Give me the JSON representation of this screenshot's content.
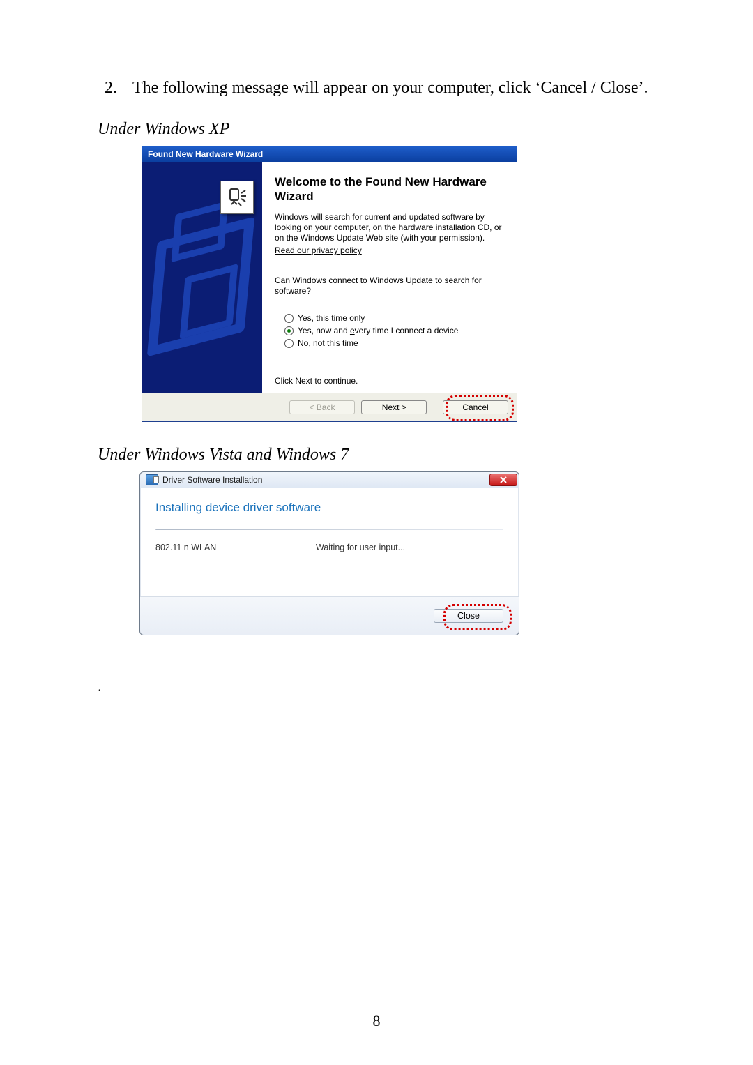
{
  "step_number": "2.",
  "step_text": "The following message will appear on your computer, click ‘Cancel / Close’.",
  "heading_xp": "Under Windows XP",
  "heading_vista": "Under Windows Vista and Windows 7",
  "page_number": "8",
  "trailing_period": ".",
  "xp": {
    "title": "Found New Hardware Wizard",
    "heading": "Welcome to the Found New Hardware Wizard",
    "intro": "Windows will search for current and updated software by looking on your computer, on the hardware installation CD, or on the Windows Update Web site (with your permission).",
    "privacy_link": "Read our privacy policy",
    "question": "Can Windows connect to Windows Update to search for software?",
    "opt1_pre": "Y",
    "opt1_rest": "es, this time only",
    "opt2_pre": "Yes, now and ",
    "opt2_u": "e",
    "opt2_rest": "very time I connect a device",
    "opt3_pre": "No, not this ",
    "opt3_u": "t",
    "opt3_rest": "ime",
    "click_next": "Click Next to continue.",
    "back_pre": "< ",
    "back_u": "B",
    "back_rest": "ack",
    "next_u": "N",
    "next_rest": "ext >",
    "cancel": "Cancel"
  },
  "vista": {
    "title": "Driver Software Installation",
    "heading": "Installing device driver software",
    "device": "802.11 n WLAN",
    "status": "Waiting for user input...",
    "close": "Close"
  }
}
